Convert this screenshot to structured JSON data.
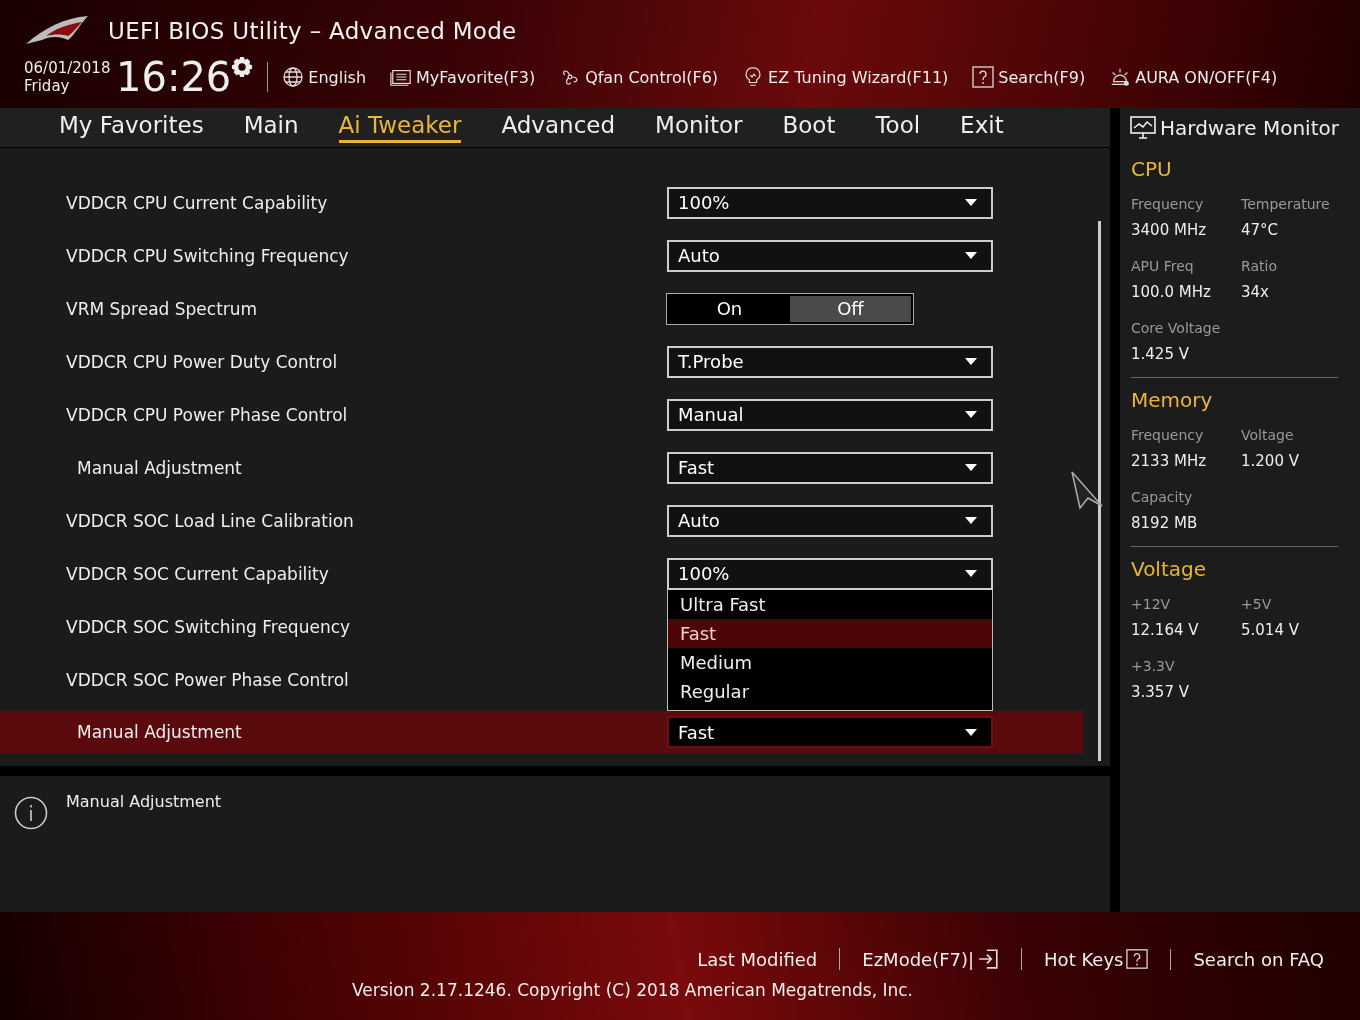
{
  "header": {
    "title": "UEFI BIOS Utility – Advanced Mode",
    "date": "06/01/2018",
    "day": "Friday",
    "time": "16:26",
    "tools": [
      {
        "kind": "language",
        "label": "English"
      },
      {
        "kind": "favorite",
        "label": "MyFavorite(F3)"
      },
      {
        "kind": "fan",
        "label": "Qfan Control(F6)"
      },
      {
        "kind": "wizard",
        "label": "EZ Tuning Wizard(F11)"
      },
      {
        "kind": "search",
        "label": "Search(F9)"
      },
      {
        "kind": "aura",
        "label": "AURA ON/OFF(F4)"
      }
    ]
  },
  "tabs": [
    {
      "label": "My Favorites",
      "selected": false
    },
    {
      "label": "Main",
      "selected": false
    },
    {
      "label": "Ai Tweaker",
      "selected": true
    },
    {
      "label": "Advanced",
      "selected": false
    },
    {
      "label": "Monitor",
      "selected": false
    },
    {
      "label": "Boot",
      "selected": false
    },
    {
      "label": "Tool",
      "selected": false
    },
    {
      "label": "Exit",
      "selected": false
    }
  ],
  "settings": [
    {
      "label": "VDDCR CPU Current Capability",
      "kind": "dropdown",
      "value": "100%",
      "selected": false
    },
    {
      "label": "VDDCR CPU Switching Frequency",
      "kind": "dropdown",
      "value": "Auto",
      "selected": false
    },
    {
      "label": "VRM Spread Spectrum",
      "kind": "toggle",
      "options": [
        {
          "label": "On",
          "selected": false
        },
        {
          "label": "Off",
          "selected": true
        }
      ],
      "selected": false
    },
    {
      "label": "VDDCR CPU Power Duty Control",
      "kind": "dropdown",
      "value": "T.Probe",
      "selected": false
    },
    {
      "label": "VDDCR CPU Power Phase Control",
      "kind": "dropdown",
      "value": "Manual",
      "selected": false,
      "children": [
        {
          "label": "Manual Adjustment",
          "kind": "dropdown",
          "value": "Fast",
          "selected": false
        }
      ]
    },
    {
      "label": "VDDCR SOC Load Line Calibration",
      "kind": "dropdown",
      "value": "Auto",
      "selected": false
    },
    {
      "label": "VDDCR SOC Current Capability",
      "kind": "dropdown",
      "value": "100%",
      "expanded": true,
      "selected": false,
      "options": [
        {
          "label": "Ultra Fast",
          "selected": false
        },
        {
          "label": "Fast",
          "selected": true
        },
        {
          "label": "Medium",
          "selected": false
        },
        {
          "label": "Regular",
          "selected": false
        }
      ]
    },
    {
      "label": "VDDCR SOC Switching Frequency",
      "selected": false
    },
    {
      "label": "VDDCR SOC Power Phase Control",
      "selected": false,
      "children": [
        {
          "label": "Manual Adjustment",
          "kind": "dropdown",
          "value": "Fast",
          "selected": true
        }
      ]
    }
  ],
  "help": {
    "text": "Manual Adjustment"
  },
  "monitor": {
    "title": "Hardware Monitor",
    "sections": [
      {
        "title": "CPU",
        "items": [
          {
            "label": "Frequency",
            "value": "3400 MHz"
          },
          {
            "label": "Temperature",
            "value": "47°C"
          },
          {
            "label": "APU Freq",
            "value": "100.0 MHz"
          },
          {
            "label": "Ratio",
            "value": "34x"
          },
          {
            "label": "Core Voltage",
            "value": "1.425 V"
          }
        ]
      },
      {
        "title": "Memory",
        "items": [
          {
            "label": "Frequency",
            "value": "2133 MHz"
          },
          {
            "label": "Voltage",
            "value": "1.200 V"
          },
          {
            "label": "Capacity",
            "value": "8192 MB"
          }
        ]
      },
      {
        "title": "Voltage",
        "items": [
          {
            "label": "+12V",
            "value": "12.164 V"
          },
          {
            "label": "+5V",
            "value": "5.014 V"
          },
          {
            "label": "+3.3V",
            "value": "3.357 V"
          }
        ]
      }
    ]
  },
  "footer": {
    "links": [
      {
        "kind": "plain",
        "label": "Last Modified"
      },
      {
        "kind": "exit",
        "label": "EzMode(F7)|"
      },
      {
        "kind": "help",
        "label": "Hot Keys"
      },
      {
        "kind": "plain",
        "label": "Search on FAQ"
      }
    ],
    "version": "Version 2.17.1246. Copyright (C) 2018 American Megatrends, Inc."
  }
}
